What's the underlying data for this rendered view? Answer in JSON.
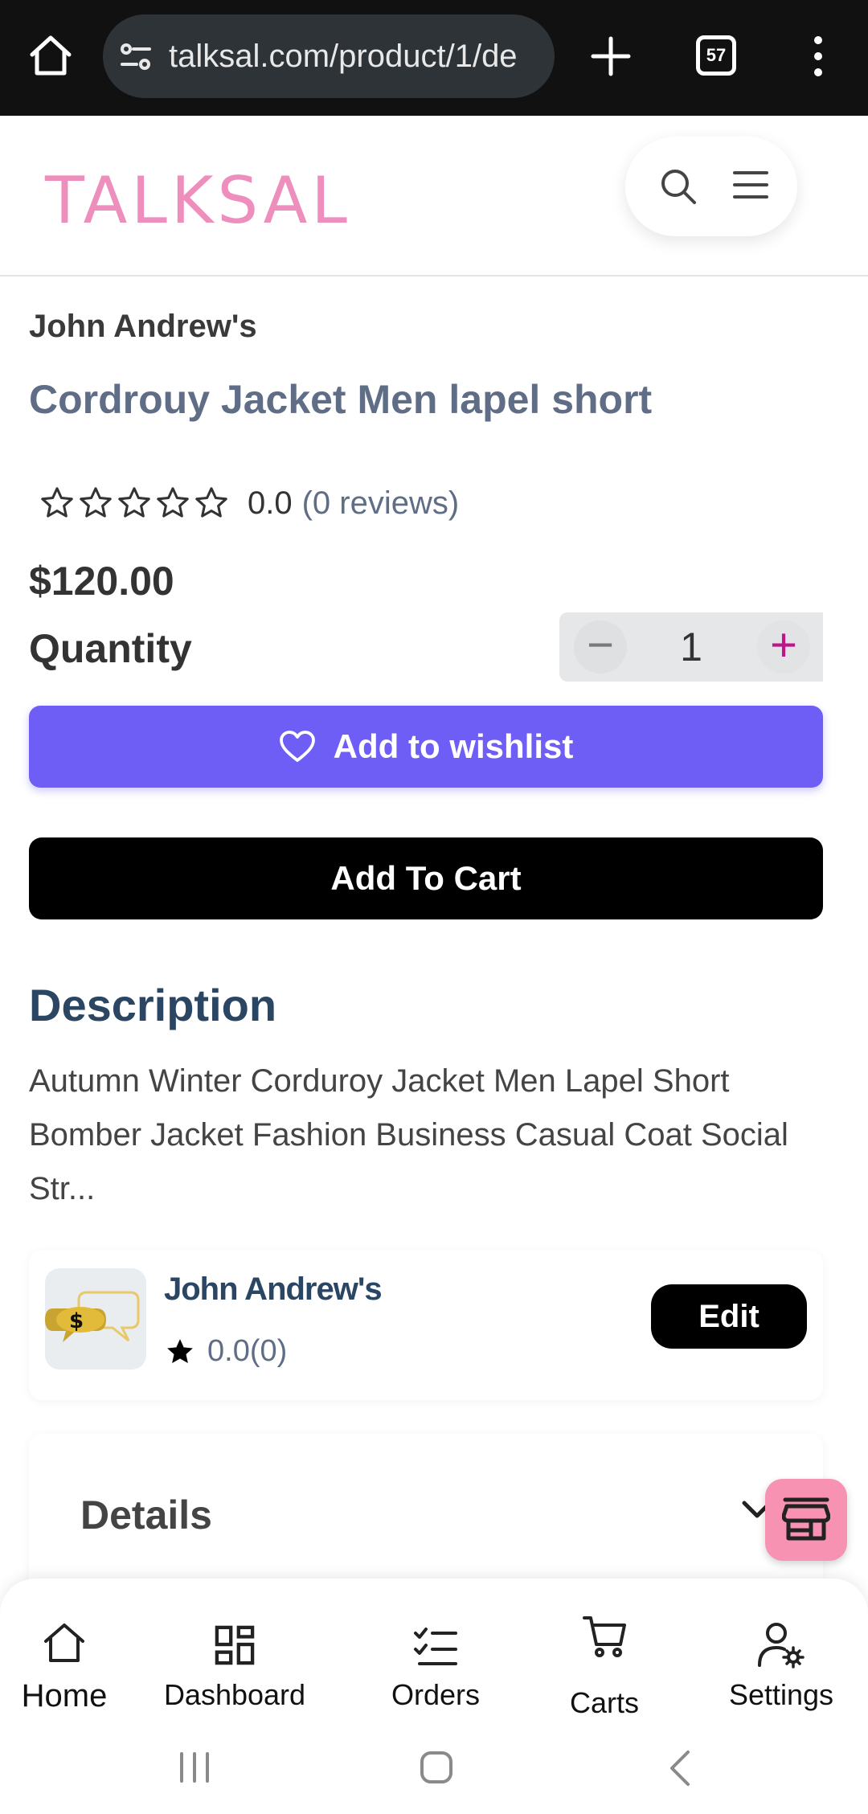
{
  "browser": {
    "url": "talksal.com/product/1/de",
    "tab_count": "57"
  },
  "header": {
    "logo": "TALKSAL"
  },
  "product": {
    "brand": "John Andrew's",
    "title": "Cordrouy Jacket Men lapel short",
    "rating": "0.0",
    "reviews": "(0 reviews)",
    "stars_filled": 0,
    "stars_total": 5,
    "price": "$120.00",
    "quantity_label": "Quantity",
    "quantity": "1",
    "wishlist_label": "Add to wishlist",
    "cart_label": "Add To Cart"
  },
  "description": {
    "title": "Description",
    "text": "Autumn Winter Corduroy Jacket Men Lapel Short Bomber Jacket Fashion Business Casual Coat Social Str..."
  },
  "seller": {
    "name": "John Andrew's",
    "rating": "0.0(0)",
    "edit_label": "Edit"
  },
  "details": {
    "title": "Details"
  },
  "bottom_nav": {
    "items": [
      {
        "label": "Home",
        "icon": "home-icon"
      },
      {
        "label": "Dashboard",
        "icon": "dashboard-icon"
      },
      {
        "label": "Orders",
        "icon": "orders-icon"
      },
      {
        "label": "Carts",
        "icon": "cart-icon"
      },
      {
        "label": "Settings",
        "icon": "settings-user-icon"
      }
    ]
  },
  "colors": {
    "logo": "#ee8ebc",
    "title": "#5f6e86",
    "wishlist": "#6f5ef5",
    "heading": "#2b4663",
    "plus": "#c0148a",
    "store_fab": "#f792b3"
  }
}
